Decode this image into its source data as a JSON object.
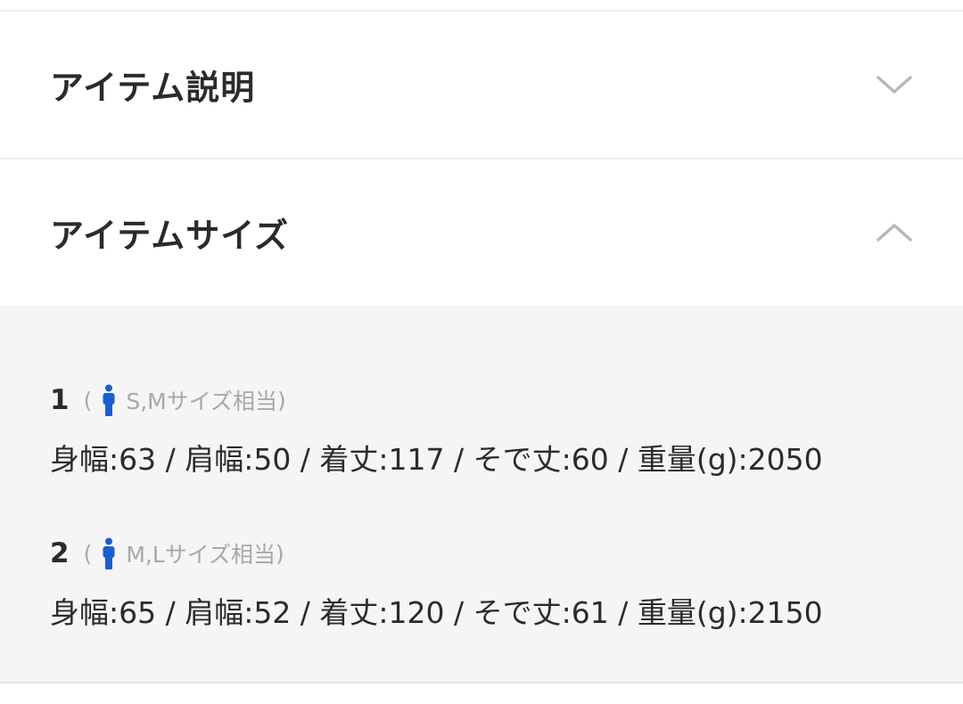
{
  "sections": {
    "description": {
      "title": "アイテム説明",
      "icon": "chevron-down-icon",
      "expanded": false
    },
    "size": {
      "title": "アイテムサイズ",
      "icon": "chevron-up-icon",
      "expanded": true
    }
  },
  "sizes": [
    {
      "number": "1",
      "open_paren": "(",
      "icon": "person-icon",
      "label": "S,Mサイズ相当",
      "close_paren": ")",
      "measurements": "身幅:63 / 肩幅:50 / 着丈:117 / そで丈:60 / 重量(g):2050"
    },
    {
      "number": "2",
      "open_paren": "(",
      "icon": "person-icon",
      "label": "M,Lサイズ相当",
      "close_paren": ")",
      "measurements": "身幅:65 / 肩幅:52 / 着丈:120 / そで丈:61 / 重量(g):2150"
    }
  ],
  "colors": {
    "person_icon": "#1a5fd1",
    "chevron": "#b8b8b8",
    "panel_bg": "#f5f5f5"
  }
}
